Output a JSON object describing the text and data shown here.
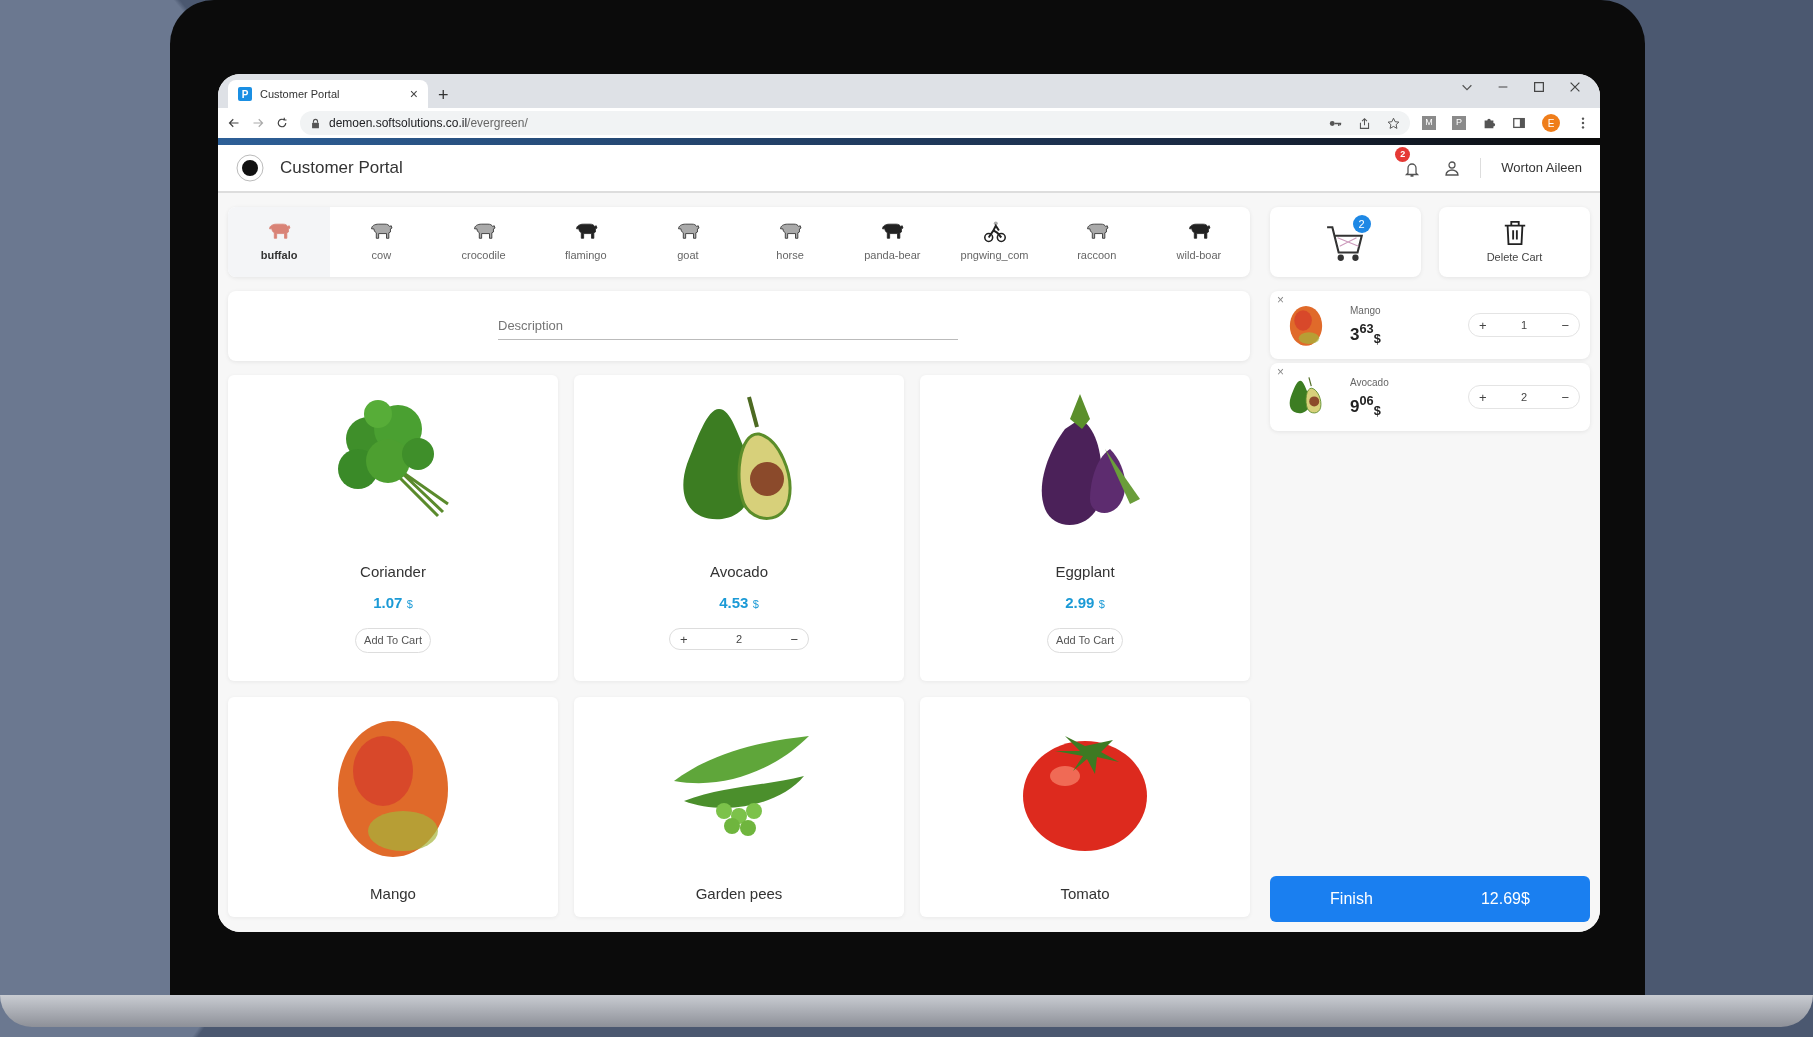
{
  "browser": {
    "favicon": "P",
    "tab_title": "Customer Portal",
    "tab_close": "×",
    "new_tab": "+",
    "url_host": "demoen.softsolutions.co.il",
    "url_path": "/evergreen/",
    "extensions": [
      "M",
      "P"
    ],
    "profile": "E"
  },
  "header": {
    "title": "Customer Portal",
    "notifications": "2",
    "user": "Worton Aileen"
  },
  "categories": [
    {
      "label": "buffalo",
      "selected": true
    },
    {
      "label": "cow",
      "selected": false
    },
    {
      "label": "crocodile",
      "selected": false
    },
    {
      "label": "flamingo",
      "selected": false
    },
    {
      "label": "goat",
      "selected": false
    },
    {
      "label": "horse",
      "selected": false
    },
    {
      "label": "panda-bear",
      "selected": false
    },
    {
      "label": "pngwing_com",
      "selected": false
    },
    {
      "label": "raccoon",
      "selected": false
    },
    {
      "label": "wild-boar",
      "selected": false
    }
  ],
  "search": {
    "placeholder": "Description"
  },
  "products": [
    {
      "kind": "herb",
      "name": "Coriander",
      "price": "1.07",
      "currency": "$",
      "action": {
        "kind": "button",
        "label": "Add To Cart"
      }
    },
    {
      "kind": "avocado",
      "name": "Avocado",
      "price": "4.53",
      "currency": "$",
      "action": {
        "kind": "stepper",
        "plus": "+",
        "quantity": "2",
        "minus": "−"
      }
    },
    {
      "kind": "eggplant",
      "name": "Eggplant",
      "price": "2.99",
      "currency": "$",
      "action": {
        "kind": "button",
        "label": "Add To Cart"
      }
    },
    {
      "kind": "mango",
      "name": "Mango"
    },
    {
      "kind": "peas",
      "name": "Garden pees"
    },
    {
      "kind": "tomato",
      "name": "Tomato"
    }
  ],
  "cart": {
    "count": "2",
    "delete_label": "Delete Cart",
    "items": [
      {
        "kind": "mango",
        "remove": "×",
        "name": "Mango",
        "price_whole": "3",
        "price_cents": "63",
        "currency": "$",
        "plus": "+",
        "quantity": "1",
        "minus": "−"
      },
      {
        "kind": "avocado",
        "remove": "×",
        "name": "Avocado",
        "price_whole": "9",
        "price_cents": "06",
        "currency": "$",
        "plus": "+",
        "quantity": "2",
        "minus": "−"
      }
    ],
    "finish_label": "Finish",
    "total": "12.69$"
  }
}
